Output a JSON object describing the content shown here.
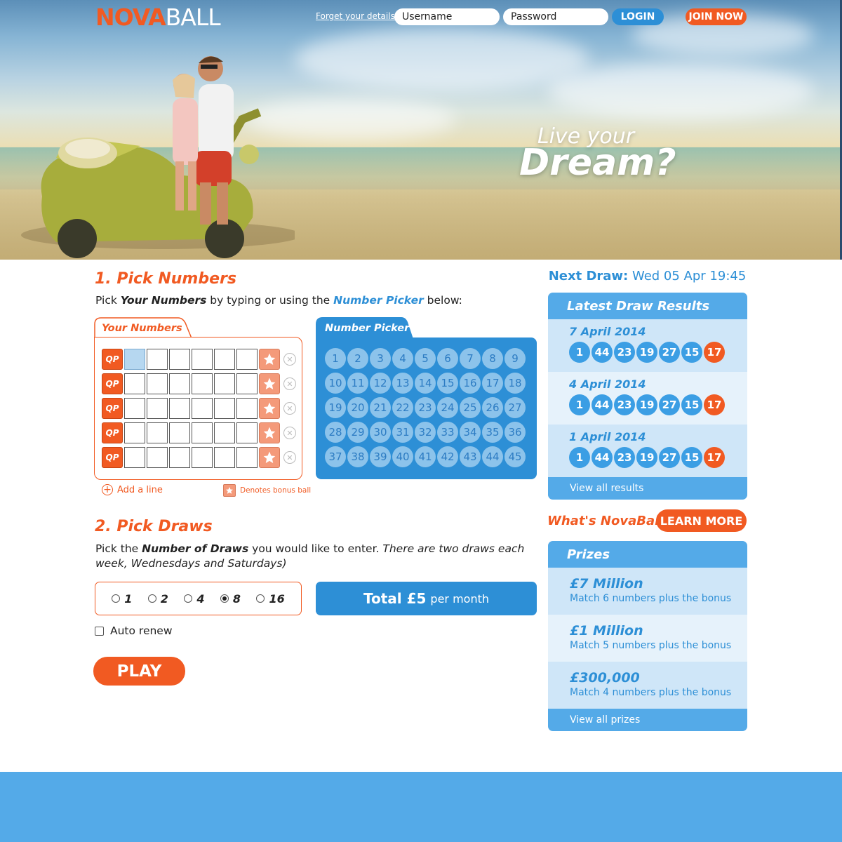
{
  "header": {
    "logo_part1": "NOVA",
    "logo_part2": "BALL",
    "forgot_link": "Forget your details?",
    "username_placeholder": "Username",
    "password_placeholder": "Password",
    "login_label": "LOGIN",
    "join_label": "JOIN NOW"
  },
  "hero": {
    "tagline_line1": "Live your",
    "tagline_line2": "Dream?"
  },
  "pick_numbers": {
    "title": "1. Pick Numbers",
    "intro_pre": "Pick ",
    "intro_bold": "Your Numbers",
    "intro_mid": " by typing or using the ",
    "intro_link": "Number Picker",
    "intro_post": " below:",
    "your_numbers_label": "Your Numbers",
    "qp_label": "QP",
    "add_line_label": "Add a line",
    "bonus_note": "Denotes bonus ball",
    "number_picker_label": "Number Picker"
  },
  "number_picker": {
    "numbers": [
      "1",
      "2",
      "3",
      "4",
      "5",
      "6",
      "7",
      "8",
      "9",
      "10",
      "11",
      "12",
      "13",
      "14",
      "15",
      "16",
      "17",
      "18",
      "19",
      "20",
      "21",
      "22",
      "23",
      "24",
      "25",
      "26",
      "27",
      "28",
      "29",
      "30",
      "31",
      "32",
      "33",
      "34",
      "35",
      "36",
      "37",
      "38",
      "39",
      "40",
      "41",
      "42",
      "43",
      "44",
      "45"
    ]
  },
  "pick_draws": {
    "title": "2. Pick Draws",
    "text_pre": "Pick the ",
    "text_bold": "Number of Draws",
    "text_mid": " you would like to enter. ",
    "text_italic": "There are two draws each week, Wednesdays and Saturdays)",
    "options": [
      "1",
      "2",
      "4",
      "8",
      "16"
    ],
    "selected": "8",
    "total_label": "Total £5",
    "total_suffix": "per month",
    "auto_renew_label": "Auto renew",
    "play_label": "PLAY"
  },
  "sidebar": {
    "next_draw_label": "Next Draw:",
    "next_draw_value": "Wed 05 Apr 19:45",
    "results_title": "Latest Draw Results",
    "results": [
      {
        "date": "7 April 2014",
        "balls": [
          "1",
          "44",
          "23",
          "19",
          "27",
          "15"
        ],
        "bonus": "17"
      },
      {
        "date": "4 April 2014",
        "balls": [
          "1",
          "44",
          "23",
          "19",
          "27",
          "15"
        ],
        "bonus": "17"
      },
      {
        "date": "1 April 2014",
        "balls": [
          "1",
          "44",
          "23",
          "19",
          "27",
          "15"
        ],
        "bonus": "17"
      }
    ],
    "view_all_results": "View all results",
    "whats_label": "What's NovaBall?",
    "learn_more": "LEARN MORE",
    "prizes_title": "Prizes",
    "prizes": [
      {
        "amount": "£7 Million",
        "desc": "Match 6 numbers plus the bonus"
      },
      {
        "amount": "£1 Million",
        "desc": "Match 5 numbers plus the bonus"
      },
      {
        "amount": "£300,000",
        "desc": "Match 4 numbers plus the bonus"
      }
    ],
    "view_all_prizes": "View all prizes"
  },
  "colors": {
    "orange": "#f15a22",
    "blue": "#2d8fd6",
    "light_blue": "#54aae8"
  }
}
